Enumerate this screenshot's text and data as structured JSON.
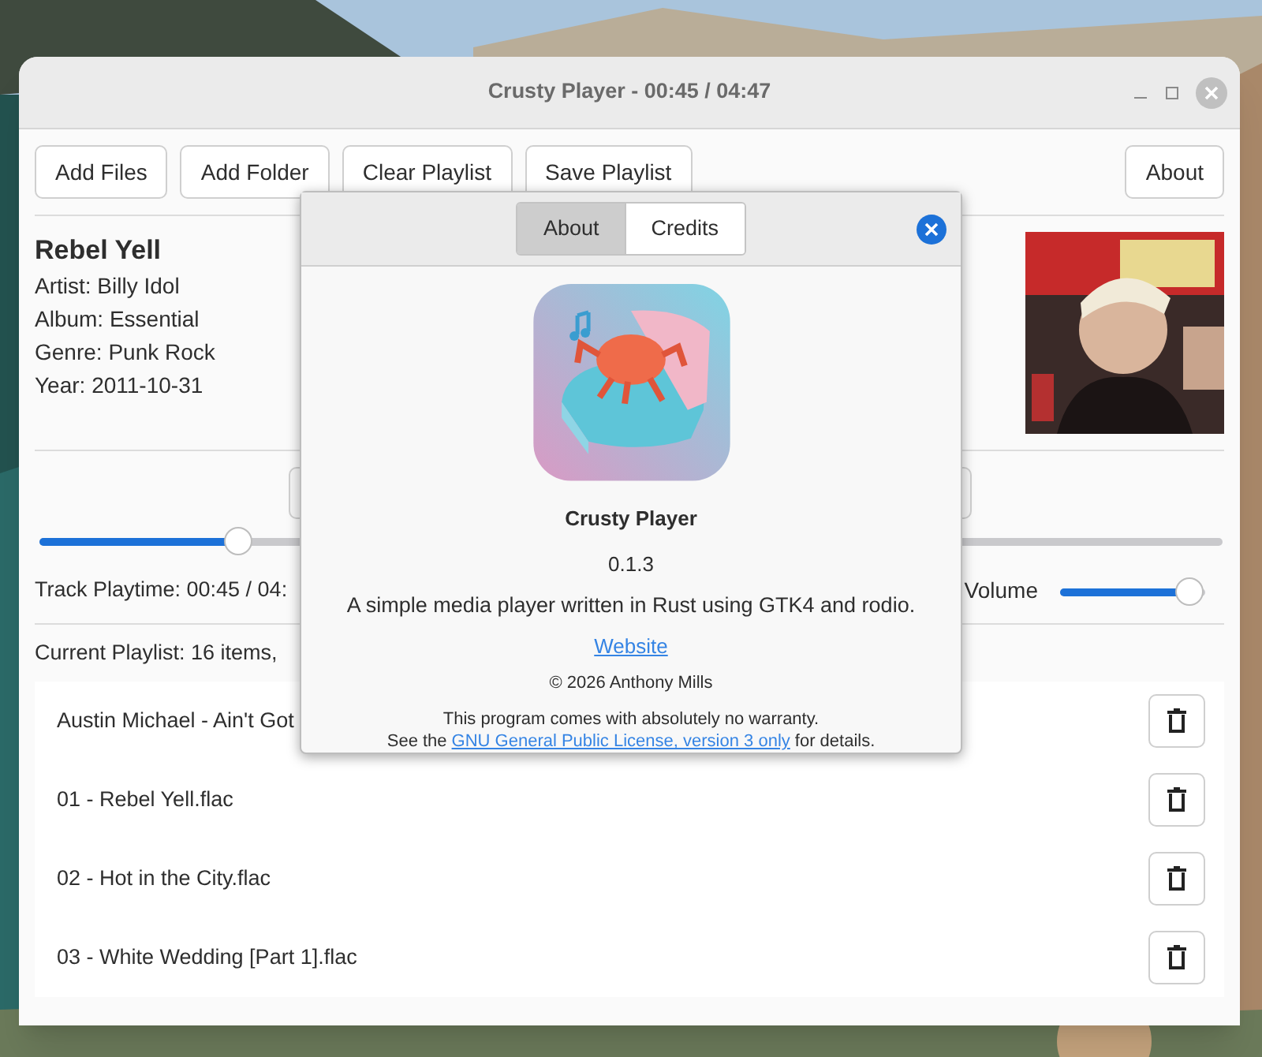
{
  "window": {
    "title": "Crusty Player - 00:45 / 04:47"
  },
  "toolbar": {
    "left_buttons": [
      "Add Files",
      "Add Folder",
      "Clear Playlist",
      "Save Playlist"
    ],
    "right_buttons": [
      "About"
    ]
  },
  "track": {
    "title": "Rebel Yell",
    "details": [
      "Artist: Billy Idol",
      "Album: Essential",
      "Genre: Punk Rock",
      "Year: 2011-10-31"
    ]
  },
  "progress": {
    "level": 0.16
  },
  "playtime": "Track Playtime: 00:45 / 04:",
  "volume": {
    "label": "Volume",
    "level": 0.98
  },
  "playlist": {
    "summary": "Current Playlist: 16 items,",
    "items": [
      {
        "name": "Austin Michael - Ain't Got"
      },
      {
        "name": "01 - Rebel Yell.flac"
      },
      {
        "name": "02 - Hot in the City.flac"
      },
      {
        "name": "03 - White Wedding [Part 1].flac"
      }
    ]
  },
  "about_dialog": {
    "tabs": [
      {
        "label": "About",
        "selected": true
      },
      {
        "label": "Credits",
        "selected": false
      }
    ],
    "app_name": "Crusty Player",
    "version": "0.1.3",
    "description": "A simple media player written in Rust using GTK4 and rodio.",
    "website": "Website",
    "copyright": "© 2026 Anthony Mills",
    "warranty": "This program comes with absolutely no warranty.",
    "license_prefix": "See the",
    "license_link": "GNU General Public License, version 3 only",
    "license_suffix": "for details."
  }
}
